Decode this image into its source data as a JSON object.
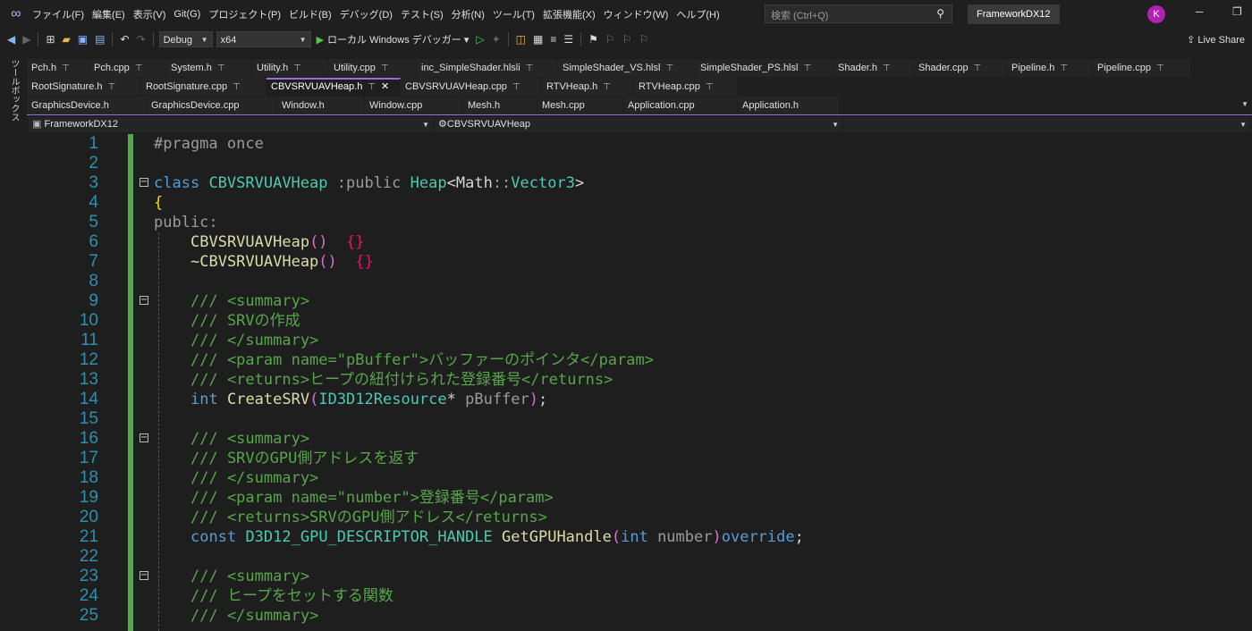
{
  "menu": {
    "items": [
      "ファイル(F)",
      "編集(E)",
      "表示(V)",
      "Git(G)",
      "プロジェクト(P)",
      "ビルド(B)",
      "デバッグ(D)",
      "テスト(S)",
      "分析(N)",
      "ツール(T)",
      "拡張機能(X)",
      "ウィンドウ(W)",
      "ヘルプ(H)"
    ],
    "search_placeholder": "検索 (Ctrl+Q)",
    "solution": "FrameworkDX12",
    "avatar": "K"
  },
  "toolbar": {
    "config": "Debug",
    "platform": "x64",
    "run_label": "ローカル Windows デバッガー",
    "live_share": "Live Share"
  },
  "toolbox": {
    "label": "ツールボックス"
  },
  "tabs": {
    "row1": [
      "Pch.h",
      "Pch.cpp",
      "System.h",
      "Utility.h",
      "Utility.cpp",
      "inc_SimpleShader.hlsli",
      "SimpleShader_VS.hlsl",
      "SimpleShader_PS.hlsl",
      "Shader.h",
      "Shader.cpp",
      "Pipeline.h",
      "Pipeline.cpp"
    ],
    "row2": [
      "RootSignature.h",
      "RootSignature.cpp",
      "CBVSRVUAVHeap.h",
      "CBVSRVUAVHeap.cpp",
      "RTVHeap.h",
      "RTVHeap.cpp"
    ],
    "row3": [
      "GraphicsDevice.h",
      "GraphicsDevice.cpp",
      "Window.h",
      "Window.cpp",
      "Mesh.h",
      "Mesh.cpp",
      "Application.cpp",
      "Application.h"
    ]
  },
  "navbar": {
    "project": "FrameworkDX12",
    "scope": "CBVSRVUAVHeap"
  },
  "code": {
    "l1_pp": "#pragma once",
    "l3_kw": "class",
    "l3_cls": "CBVSRVUAVHeap",
    "l3_colon": " :",
    "l3_pub": "public",
    "l3_heap": "Heap",
    "l3_lt": "<",
    "l3_math": "Math",
    "l3_sep": "::",
    "l3_vec": "Vector3",
    "l3_gt": ">",
    "l4": "{",
    "l5": "public:",
    "l6_fn": "CBVSRVUAVHeap",
    "l6_paren": "()",
    "l6_body": "{}",
    "l7_fn": "~CBVSRVUAVHeap",
    "l7_paren": "()",
    "l7_body": "{}",
    "l9": "/// <summary>",
    "l10": "/// SRVの作成",
    "l11": "/// </summary>",
    "l12": "/// <param name=\"pBuffer\">バッファーのポインタ</param>",
    "l13": "/// <returns>ヒープの紐付けられた登録番号</returns>",
    "l14_kw": "int",
    "l14_fn": "CreateSRV",
    "l14_open": "(",
    "l14_type": "ID3D12Resource",
    "l14_star": "*",
    "l14_param": " pBuffer",
    "l14_close": ")",
    "l14_semi": ";",
    "l16": "/// <summary>",
    "l17": "/// SRVのGPU側アドレスを返す",
    "l18": "/// </summary>",
    "l19": "/// <param name=\"number\">登録番号</param>",
    "l20": "/// <returns>SRVのGPU側アドレス</returns>",
    "l21_kw": "const",
    "l21_type": "D3D12_GPU_DESCRIPTOR_HANDLE",
    "l21_fn": "GetGPUHandle",
    "l21_open": "(",
    "l21_int": "int",
    "l21_param": " number",
    "l21_close": ")",
    "l21_ovr": "override",
    "l21_semi": ";",
    "l23": "/// <summary>",
    "l24": "/// ヒープをセットする関数",
    "l25": "/// </summary>"
  }
}
